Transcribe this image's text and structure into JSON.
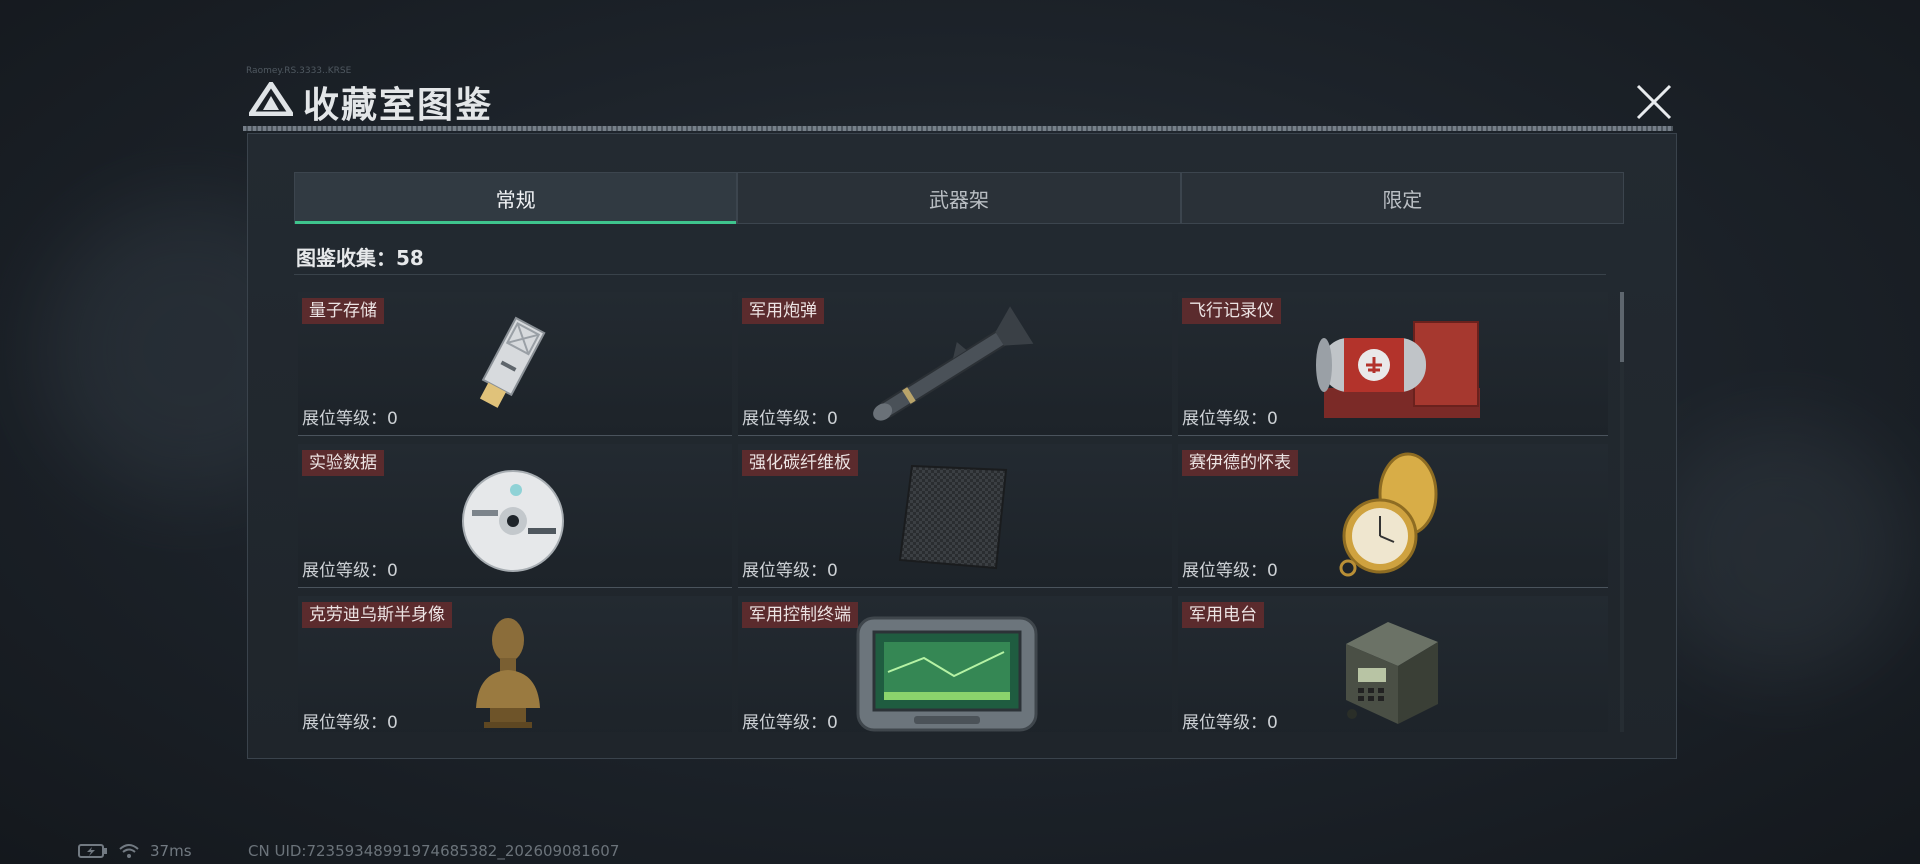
{
  "dialog": {
    "title": "收藏室图鉴",
    "tiny_header": "Raomey.RS.3333..KRSE"
  },
  "tabs": [
    {
      "label": "常规",
      "active": true
    },
    {
      "label": "武器架",
      "active": false
    },
    {
      "label": "限定",
      "active": false
    }
  ],
  "collection": {
    "label": "图鉴收集：58"
  },
  "items": [
    {
      "name": "量子存储",
      "level": "展位等级：0",
      "icon": "usb-drive"
    },
    {
      "name": "军用炮弹",
      "level": "展位等级：0",
      "icon": "missile"
    },
    {
      "name": "飞行记录仪",
      "level": "展位等级：0",
      "icon": "flight-recorder"
    },
    {
      "name": "实验数据",
      "level": "展位等级：0",
      "icon": "disc"
    },
    {
      "name": "强化碳纤维板",
      "level": "展位等级：0",
      "icon": "carbon-plate"
    },
    {
      "name": "赛伊德的怀表",
      "level": "展位等级：0",
      "icon": "pocket-watch"
    },
    {
      "name": "克劳迪乌斯半身像",
      "level": "展位等级：0",
      "icon": "bust"
    },
    {
      "name": "军用控制终端",
      "level": "展位等级：0",
      "icon": "control-terminal"
    },
    {
      "name": "军用电台",
      "level": "展位等级：0",
      "icon": "radio"
    }
  ],
  "status": {
    "ping": "37ms",
    "uid": "CN UID:72359348991974685382_202609081607"
  },
  "colors": {
    "accent": "#3fc48d",
    "tag_bg": "#5b2b2d"
  }
}
